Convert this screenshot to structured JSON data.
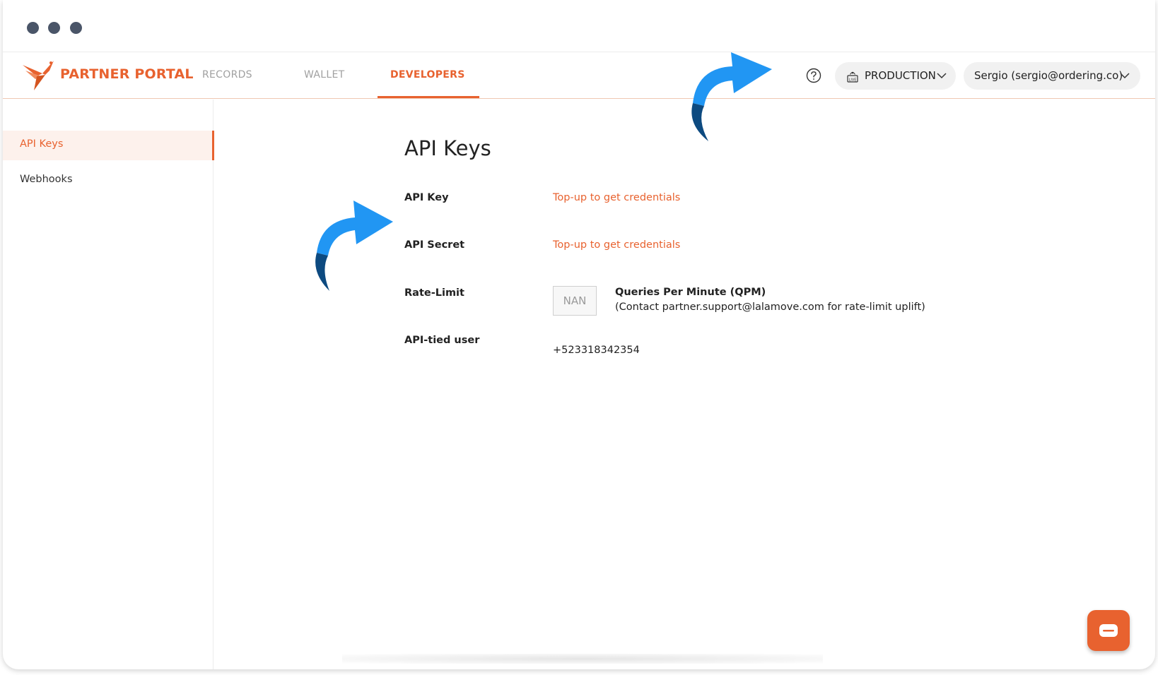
{
  "brand": {
    "name": "PARTNER PORTAL",
    "color": "#e8622f"
  },
  "nav": {
    "tabs": [
      {
        "label": "RECORDS"
      },
      {
        "label": "WALLET"
      },
      {
        "label": "DEVELOPERS",
        "active": true
      }
    ]
  },
  "header": {
    "help_icon": "question-circle-icon",
    "environment": {
      "label": "PRODUCTION",
      "icon": "live-broadcast-icon"
    },
    "user": {
      "label": "Sergio (sergio@ordering.co)"
    }
  },
  "sidebar": {
    "items": [
      {
        "label": "API Keys",
        "active": true
      },
      {
        "label": "Webhooks"
      }
    ]
  },
  "main": {
    "title": "API Keys",
    "rows": {
      "api_key": {
        "label": "API Key",
        "value": "Top-up to get credentials"
      },
      "api_secret": {
        "label": "API Secret",
        "value": "Top-up to get credentials"
      },
      "rate_limit": {
        "label": "Rate-Limit",
        "value": "NAN",
        "unit": "Queries Per Minute (QPM)",
        "note": "(Contact partner.support@lalamove.com for rate-limit uplift)"
      },
      "api_tied_user": {
        "label": "API-tied user",
        "value": "+523318342354"
      }
    }
  },
  "colors": {
    "accent": "#e8622f",
    "arrow_blue": "#2196f3",
    "arrow_dark": "#0d4a80"
  }
}
